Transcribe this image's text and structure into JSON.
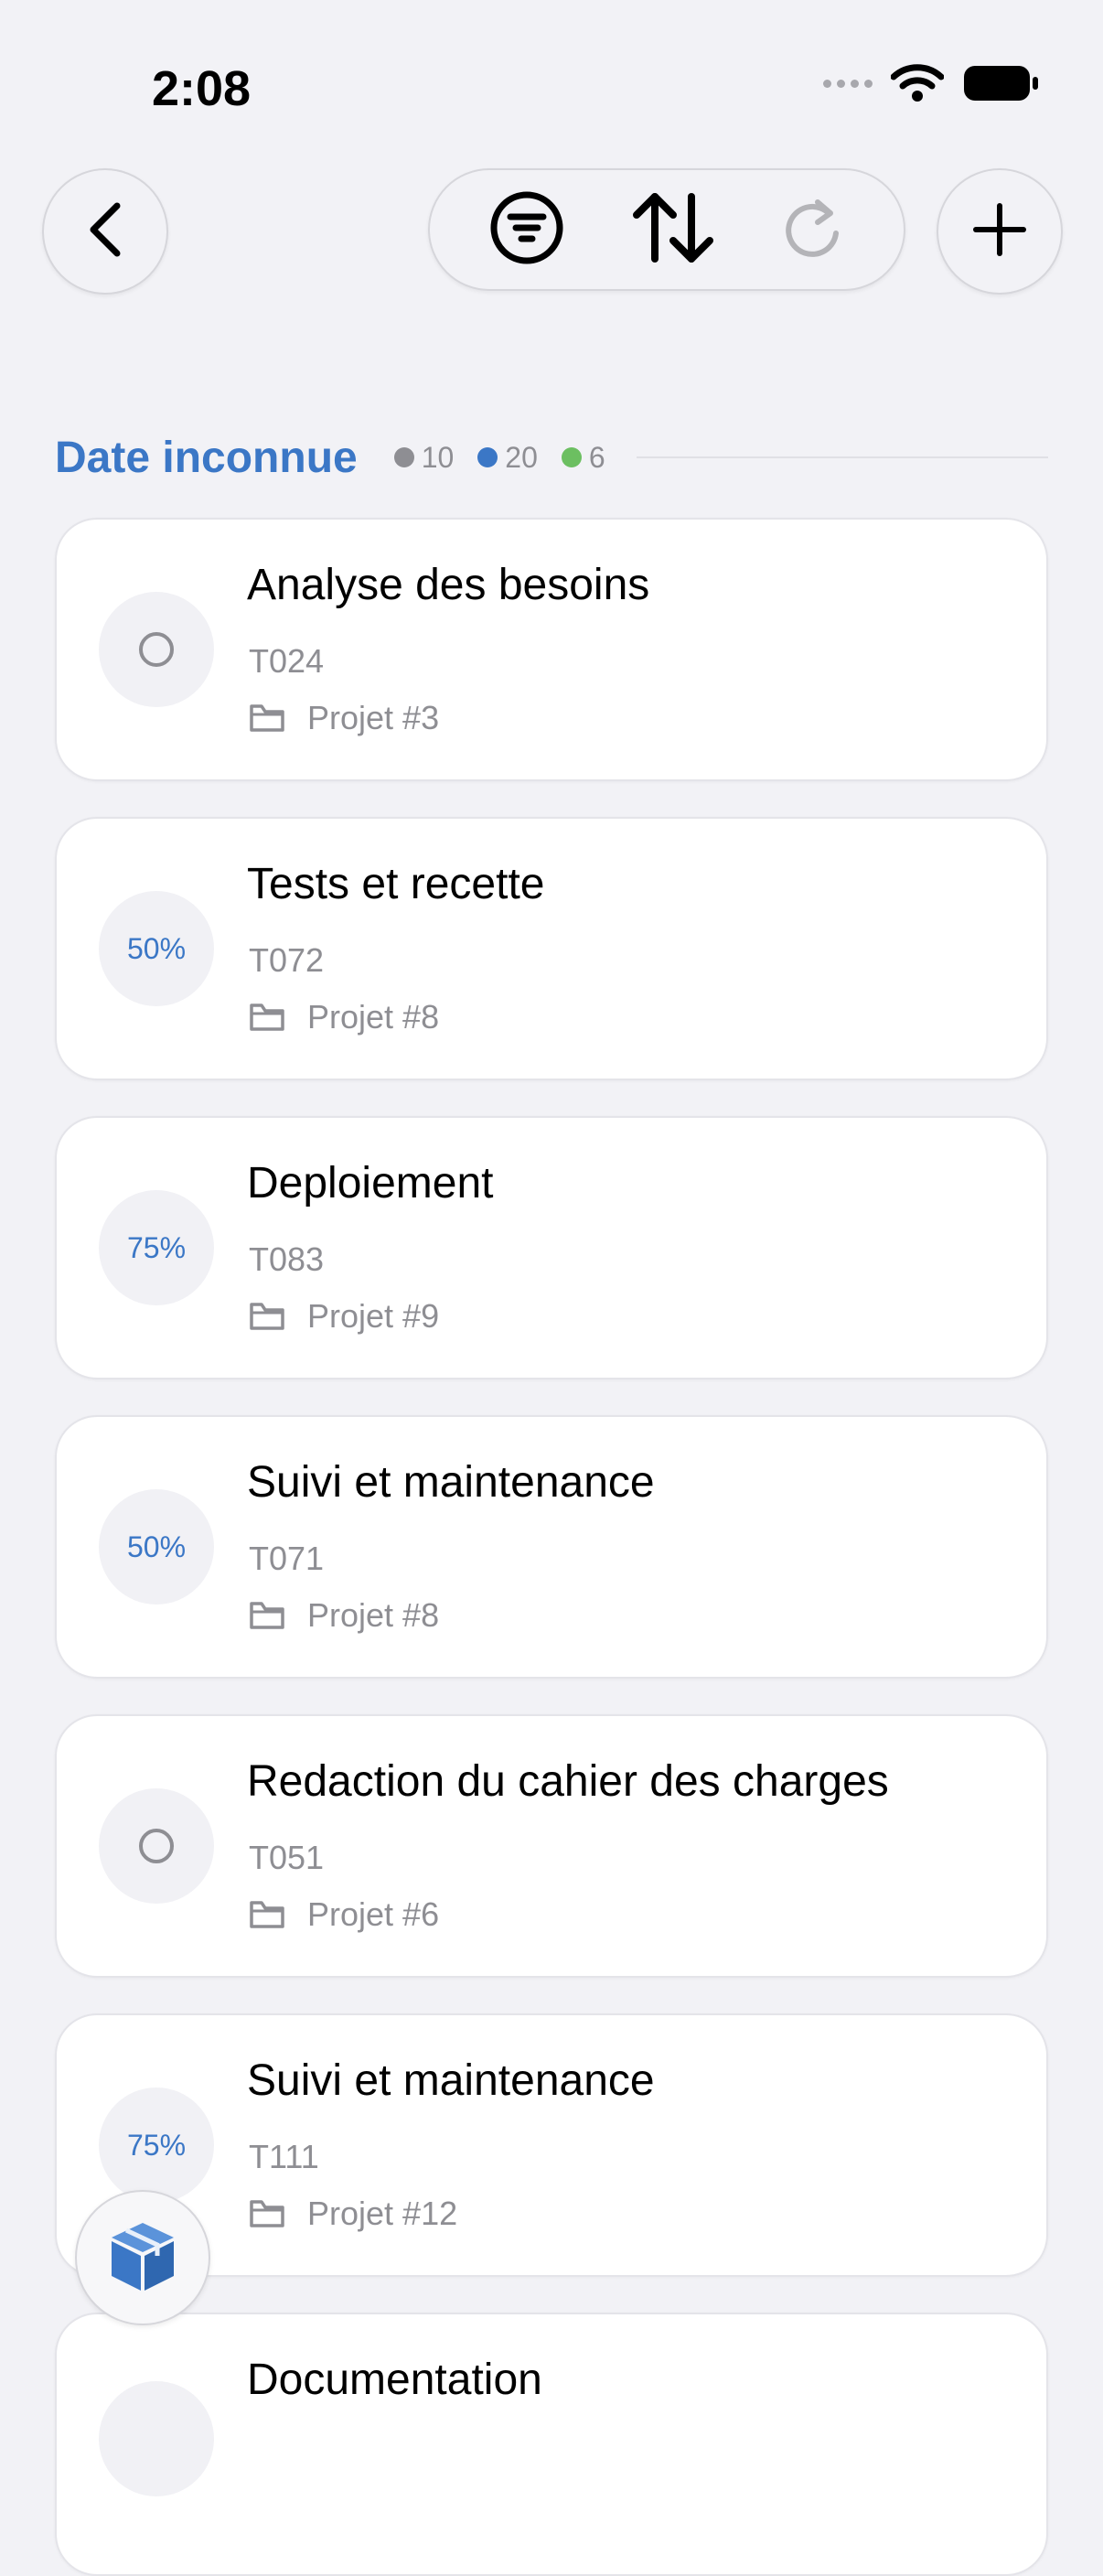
{
  "status_bar": {
    "time": "2:08"
  },
  "section": {
    "title": "Date inconnue",
    "counts": [
      {
        "value": "10",
        "color": "#8E8E93"
      },
      {
        "value": "20",
        "color": "#3B77C6"
      },
      {
        "value": "6",
        "color": "#6CBF61"
      }
    ]
  },
  "tasks": [
    {
      "title": "Analyse des besoins",
      "code": "T024",
      "project": "Projet #3",
      "progress": ""
    },
    {
      "title": "Tests et recette",
      "code": "T072",
      "project": "Projet #8",
      "progress": "50%"
    },
    {
      "title": "Deploiement",
      "code": "T083",
      "project": "Projet #9",
      "progress": "75%"
    },
    {
      "title": "Suivi et maintenance",
      "code": "T071",
      "project": "Projet #8",
      "progress": "50%"
    },
    {
      "title": "Redaction du cahier des charges",
      "code": "T051",
      "project": "Projet #6",
      "progress": ""
    },
    {
      "title": "Suivi et maintenance",
      "code": "T111",
      "project": "Projet #12",
      "progress": "75%"
    },
    {
      "title": "Documentation",
      "code": "",
      "project": "",
      "progress": ""
    }
  ],
  "icons": {
    "back": "chevron-left-icon",
    "filter": "filter-icon",
    "sort": "sort-icon",
    "refresh": "refresh-icon",
    "add": "plus-icon",
    "fab": "cube-icon",
    "folder": "folder-icon"
  },
  "colors": {
    "accent": "#3B77C6",
    "background": "#F2F2F6"
  }
}
